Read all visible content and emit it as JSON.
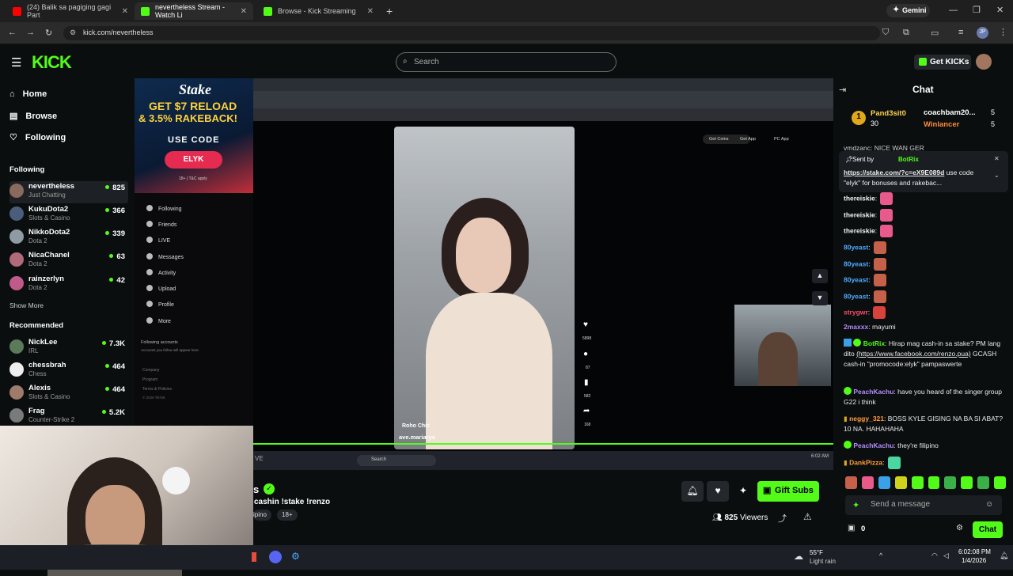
{
  "browser": {
    "tabs": [
      {
        "label": "(24) Balik sa pagiging gagi Part"
      },
      {
        "label": "nevertheless Stream - Watch Li"
      },
      {
        "label": "Browse - Kick Streaming"
      }
    ],
    "url": "kick.com/nevertheless",
    "gemini": "Gemini"
  },
  "header": {
    "search_placeholder": "Search",
    "get_kicks": "Get KICKs"
  },
  "sidebar": {
    "nav": [
      {
        "label": "Home"
      },
      {
        "label": "Browse"
      },
      {
        "label": "Following"
      }
    ],
    "following_title": "Following",
    "following": [
      {
        "name": "nevertheless",
        "category": "Just Chatting",
        "viewers": "825"
      },
      {
        "name": "KukuDota2",
        "category": "Slots & Casino",
        "viewers": "366"
      },
      {
        "name": "NikkoDota2",
        "category": "Dota 2",
        "viewers": "339"
      },
      {
        "name": "NicaChanel",
        "category": "Dota 2",
        "viewers": "63"
      },
      {
        "name": "rainzerlyn",
        "category": "Dota 2",
        "viewers": "42"
      }
    ],
    "show_more": "Show More",
    "recommended_title": "Recommended",
    "recommended": [
      {
        "name": "NickLee",
        "category": "IRL",
        "viewers": "7.3K"
      },
      {
        "name": "chessbrah",
        "category": "Chess",
        "viewers": "464"
      },
      {
        "name": "Alexis",
        "category": "Slots & Casino",
        "viewers": "464"
      },
      {
        "name": "Frag",
        "category": "Counter-Strike 2",
        "viewers": "5.2K"
      }
    ]
  },
  "stake_ad": {
    "brand": "Stake",
    "line1": "GET $7 RELOAD",
    "line2": "& 3.5% RAKEBACK!",
    "use_code": "USE CODE",
    "code": "ELYK",
    "fine": "18+ | T&C apply"
  },
  "tiktok": {
    "nav": [
      "Following",
      "Friends",
      "LIVE",
      "Messages",
      "Activity",
      "Upload",
      "Profile",
      "More"
    ],
    "following_accounts": "Following accounts",
    "following_hint": "Accounts you follow will appear here",
    "footer": [
      "Company",
      "Program",
      "Terms & Policies",
      "© 2026 TikTok"
    ],
    "top_buttons": [
      "Get Coins",
      "Get App",
      "PC App"
    ],
    "counts": [
      "5898",
      "87",
      "582",
      "168"
    ],
    "handle": "ave.mariarys",
    "sound": "Roho Chic",
    "inner_search": "Search"
  },
  "stream": {
    "title_tail": "s",
    "subtitle": "cashin !stake !renzo",
    "tags": [
      "ipino",
      "18+"
    ],
    "viewers": "825",
    "viewers_label": "Viewers",
    "gift_subs": "Gift Subs",
    "overlay_left": "VE"
  },
  "chat": {
    "title": "Chat",
    "leaders": [
      {
        "rank": "1",
        "name": "Pand3sit0",
        "count": "30"
      },
      {
        "name": "coachbam20...",
        "count": "5"
      },
      {
        "name": "Winlancer",
        "count": "5"
      }
    ],
    "cut_line": "vmdzanc: NICE WAN GER",
    "pinned": {
      "sent_by": "Sent by",
      "sender": "BotRix",
      "link": "https://stake.com/?c=eX9E089d",
      "text": " use code \"elyk\" for bonuses and rakebac..."
    },
    "messages": [
      {
        "user": "thereiskie",
        "text": "",
        "color": "#f4f4f4"
      },
      {
        "user": "thereiskie",
        "text": "",
        "color": "#f4f4f4"
      },
      {
        "user": "thereiskie",
        "text": "",
        "color": "#f4f4f4"
      },
      {
        "user": "80yeast",
        "text": "",
        "color": "#4fa9ff"
      },
      {
        "user": "80yeast",
        "text": "",
        "color": "#4fa9ff"
      },
      {
        "user": "80yeast",
        "text": "",
        "color": "#4fa9ff"
      },
      {
        "user": "80yeast",
        "text": "",
        "color": "#4fa9ff"
      },
      {
        "user": "strygwr",
        "text": "",
        "color": "#ff4d6d"
      },
      {
        "user": "2maxxx",
        "text": "mayumi",
        "color": "#b58cff"
      }
    ],
    "botrix_msg": {
      "user": "BotRix",
      "pre": "Hirap mag cash-in sa stake? PM lang dito ",
      "link": "(https://www.facebook.com/renzo.pua)",
      "post": " GCASH cash-in \"promocode:elyk\" pampaswerte"
    },
    "messages2": [
      {
        "user": "PeachKachu",
        "text": "have you heard of the singer group G22 i think",
        "color": "#b58cff"
      },
      {
        "user": "neggy_321",
        "text": "BOSS KYLE GISING NA BA SI ABAT? 10 NA. HAHAHAHA",
        "color": "#ff9d3b"
      },
      {
        "user": "PeachKachu",
        "text": "they're filipino",
        "color": "#b58cff"
      },
      {
        "user": "DankPizza",
        "text": "",
        "color": "#ff9d3b"
      }
    ],
    "input_placeholder": "Send a message",
    "points": "0",
    "chat_button": "Chat"
  },
  "taskbar": {
    "weather_temp": "55°F",
    "weather_desc": "Light rain",
    "time": "6:02:08 PM",
    "date": "1/4/2026",
    "inner_time": "6:02 AM"
  }
}
